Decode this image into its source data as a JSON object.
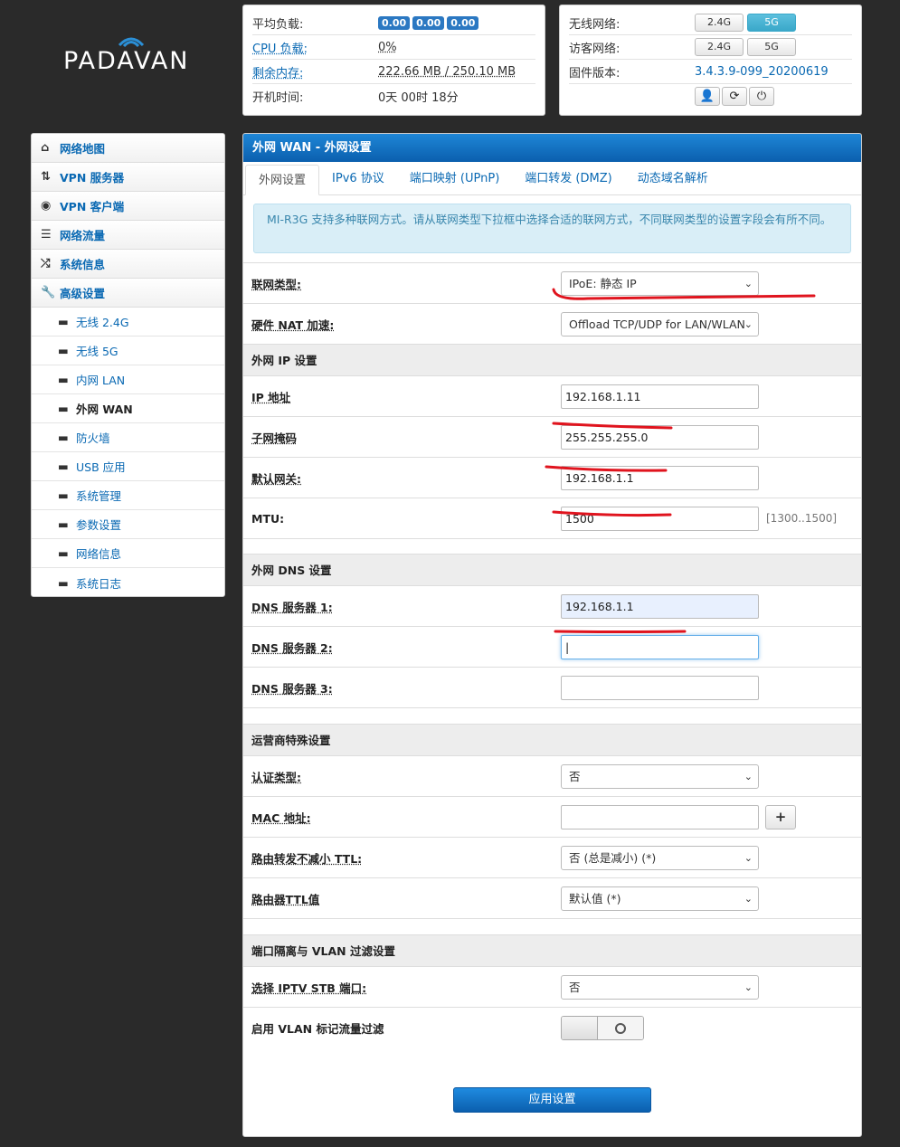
{
  "logo": {
    "text": "PADAVAN"
  },
  "status_left": {
    "rows": [
      {
        "label": "平均负载:",
        "badges": [
          "0.00",
          "0.00",
          "0.00"
        ]
      },
      {
        "label": "CPU 负载:",
        "value": "0%"
      },
      {
        "label": "剩余内存:",
        "value": "222.66 MB / 250.10 MB"
      },
      {
        "label": "开机时间:",
        "value": "0天 00时 18分"
      }
    ]
  },
  "status_right": {
    "wireless_label": "无线网络:",
    "guest_label": "访客网络:",
    "firmware_label": "固件版本:",
    "firmware_value": "3.4.3.9-099_20200619",
    "band_24": "2.4G",
    "band_5": "5G",
    "guest_24": "2.4G",
    "guest_5": "5G"
  },
  "sidebar": {
    "main_items": [
      {
        "label": "网络地图",
        "icon": "home-icon"
      },
      {
        "label": "VPN 服务器",
        "icon": "retweet-icon"
      },
      {
        "label": "VPN 客户端",
        "icon": "globe-icon"
      },
      {
        "label": "网络流量",
        "icon": "list-icon"
      },
      {
        "label": "系统信息",
        "icon": "random-icon"
      },
      {
        "label": "高级设置",
        "icon": "wrench-icon"
      }
    ],
    "sub_items": [
      "无线 2.4G",
      "无线 5G",
      "内网 LAN",
      "外网 WAN",
      "防火墙",
      "USB 应用",
      "系统管理",
      "参数设置",
      "网络信息",
      "系统日志"
    ],
    "active_sub": "外网 WAN"
  },
  "main": {
    "header": "外网 WAN - 外网设置",
    "tabs": [
      "外网设置",
      "IPv6 协议",
      "端口映射 (UPnP)",
      "端口转发 (DMZ)",
      "动态域名解析"
    ],
    "alert": "MI-R3G 支持多种联网方式。请从联网类型下拉框中选择合适的联网方式，不同联网类型的设置字段会有所不同。",
    "wan_type_label": "联网类型:",
    "wan_type_value": "IPoE: 静态 IP",
    "hw_nat_label": "硬件 NAT 加速:",
    "hw_nat_value": "Offload TCP/UDP for LAN/WLAN",
    "ip_section": "外网 IP 设置",
    "ip_label": "IP 地址",
    "ip_value": "192.168.1.11",
    "mask_label": "子网掩码",
    "mask_value": "255.255.255.0",
    "gw_label": "默认网关:",
    "gw_value": "192.168.1.1",
    "mtu_label": "MTU:",
    "mtu_value": "1500",
    "mtu_hint": "[1300..1500]",
    "dns_section": "外网 DNS 设置",
    "dns1_label": "DNS 服务器 1:",
    "dns1_value": "192.168.1.1",
    "dns2_label": "DNS 服务器 2:",
    "dns2_value": "|",
    "dns3_label": "DNS 服务器 3:",
    "dns3_value": "",
    "isp_section": "运营商特殊设置",
    "auth_label": "认证类型:",
    "auth_value": "否",
    "mac_label": "MAC 地址:",
    "mac_value": "",
    "mac_btn": "+",
    "ttl_label": "路由转发不减小 TTL:",
    "ttl_value": "否 (总是减小) (*)",
    "ttl_val_label": "路由器TTL值",
    "ttl_val_value": "默认值 (*)",
    "vlan_section": "端口隔离与 VLAN 过滤设置",
    "iptv_label": "选择 IPTV STB 端口:",
    "iptv_value": "否",
    "vlan_filter_label": "启用 VLAN 标记流量过滤",
    "apply_label": "应用设置"
  },
  "colors": {
    "accent": "#0a69b3",
    "header_blue": "#0b5fae",
    "annotation_red": "#e0141e"
  }
}
